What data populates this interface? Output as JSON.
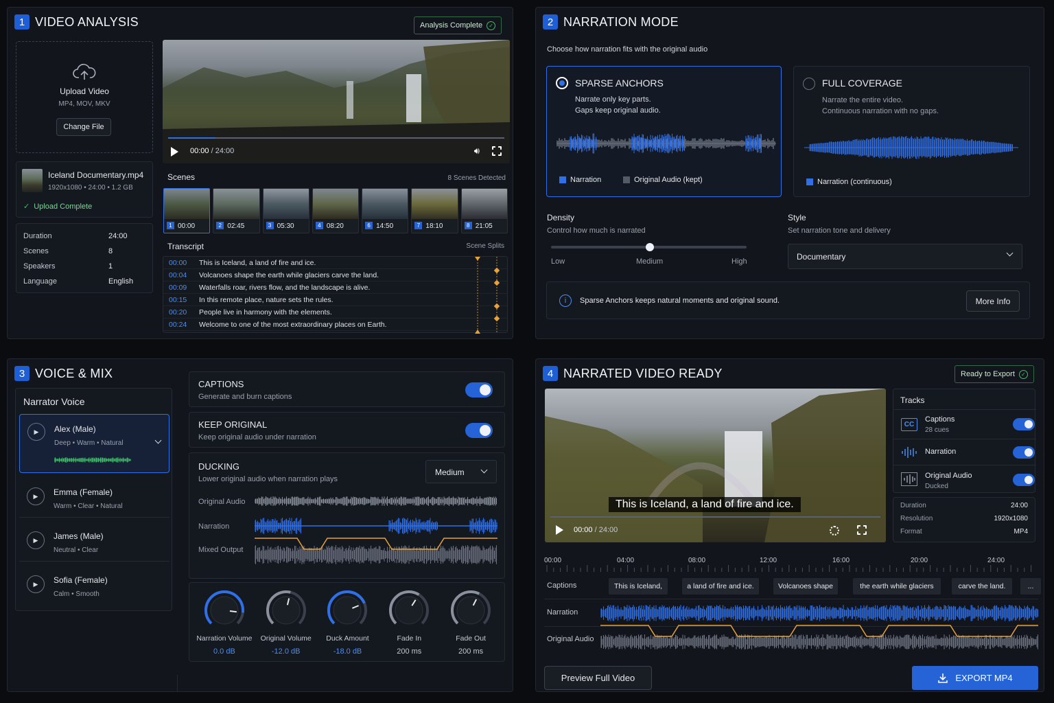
{
  "q1": {
    "num": "1",
    "title": "VIDEO ANALYSIS",
    "badge": "Analysis Complete",
    "upload": {
      "title": "Upload Video",
      "formats": "MP4, MOV, MKV",
      "button": "Change File"
    },
    "file": {
      "name": "Iceland Documentary.mp4",
      "meta": "1920x1080  •  24:00  •  1.2 GB",
      "status": "Upload Complete"
    },
    "stats": [
      {
        "label": "Duration",
        "value": "24:00"
      },
      {
        "label": "Scenes",
        "value": "8"
      },
      {
        "label": "Speakers",
        "value": "1"
      },
      {
        "label": "Language",
        "value": "English"
      }
    ],
    "player": {
      "time": "00:00",
      "total": "/ 24:00"
    },
    "scenes": {
      "label": "Scenes",
      "count": "8 Scenes Detected",
      "items": [
        {
          "n": "1",
          "t": "00:00"
        },
        {
          "n": "2",
          "t": "02:45"
        },
        {
          "n": "3",
          "t": "05:30"
        },
        {
          "n": "4",
          "t": "08:20"
        },
        {
          "n": "6",
          "t": "14:50"
        },
        {
          "n": "7",
          "t": "18:10"
        },
        {
          "n": "8",
          "t": "21:05"
        }
      ]
    },
    "transcript": {
      "label": "Transcript",
      "right": "Scene Splits",
      "rows": [
        {
          "t": "00:00",
          "text": "This is Iceland, a land of fire and ice."
        },
        {
          "t": "00:04",
          "text": "Volcanoes shape the earth while glaciers carve the land."
        },
        {
          "t": "00:09",
          "text": "Waterfalls roar, rivers flow, and the landscape is alive."
        },
        {
          "t": "00:15",
          "text": "In this remote place, nature sets the rules."
        },
        {
          "t": "00:20",
          "text": "People live in harmony with the elements."
        },
        {
          "t": "00:24",
          "text": "Welcome to one of the most extraordinary places on Earth."
        }
      ]
    }
  },
  "q2": {
    "num": "2",
    "title": "NARRATION MODE",
    "subtitle": "Choose how narration fits with the original audio",
    "sparse": {
      "title": "SPARSE ANCHORS",
      "l1": "Narrate only key parts.",
      "l2": "Gaps keep original audio.",
      "legend1": "Narration",
      "legend2": "Original Audio (kept)"
    },
    "full": {
      "title": "FULL COVERAGE",
      "l1": "Narrate the entire video.",
      "l2": "Continuous narration with no gaps.",
      "legend1": "Narration (continuous)"
    },
    "density": {
      "title": "Density",
      "sub": "Control how much is narrated",
      "low": "Low",
      "mid": "Medium",
      "high": "High",
      "level": 0.5
    },
    "style": {
      "title": "Style",
      "sub": "Set narration tone and delivery",
      "value": "Documentary"
    },
    "info": {
      "text": "Sparse Anchors keeps natural moments and original sound.",
      "button": "More Info"
    }
  },
  "q3": {
    "num": "3",
    "title": "VOICE & MIX",
    "voice_title": "Narrator Voice",
    "voices": [
      {
        "name": "Alex (Male)",
        "tags": "Deep  •  Warm  •  Natural"
      },
      {
        "name": "Emma (Female)",
        "tags": "Warm  •  Clear  •  Natural"
      },
      {
        "name": "James (Male)",
        "tags": "Neutral  •  Clear"
      },
      {
        "name": "Sofia (Female)",
        "tags": "Calm  •  Smooth"
      }
    ],
    "captions": {
      "title": "CAPTIONS",
      "sub": "Generate and burn captions"
    },
    "keep": {
      "title": "KEEP ORIGINAL",
      "sub": "Keep original audio under narration"
    },
    "ducking": {
      "title": "DUCKING",
      "sub": "Lower original audio when narration plays",
      "value": "Medium",
      "rows": [
        "Original Audio",
        "Narration",
        "Mixed Output"
      ]
    },
    "knobs": [
      {
        "label": "Narration Volume",
        "value": "0.0 dB"
      },
      {
        "label": "Original Volume",
        "value": "-12.0 dB"
      },
      {
        "label": "Duck Amount",
        "value": "-18.0 dB"
      },
      {
        "label": "Fade In",
        "value": "200 ms"
      },
      {
        "label": "Fade Out",
        "value": "200 ms"
      }
    ]
  },
  "q4": {
    "num": "4",
    "title": "NARRATED VIDEO READY",
    "badge": "Ready to Export",
    "caption_overlay": "This is Iceland, a land of fire and ice.",
    "player": {
      "time": "00:00",
      "total": "/ 24:00"
    },
    "tracks": {
      "title": "Tracks",
      "items": [
        {
          "name": "Captions",
          "sub": "28 cues",
          "icon": "CC"
        },
        {
          "name": "Narration",
          "sub": ""
        },
        {
          "name": "Original Audio",
          "sub": "Ducked"
        }
      ]
    },
    "info": [
      {
        "label": "Duration",
        "value": "24:00"
      },
      {
        "label": "Resolution",
        "value": "1920x1080"
      },
      {
        "label": "Format",
        "value": "MP4"
      }
    ],
    "ruler": [
      "00:00",
      "04:00",
      "08:00",
      "12:00",
      "16:00",
      "20:00",
      "24:00"
    ],
    "timeline_labels": [
      "Captions",
      "Narration",
      "Original Audio"
    ],
    "caption_chips": [
      "This is Iceland,",
      "a land of fire and ice.",
      "Volcanoes shape",
      "the earth while glaciers",
      "carve the land.",
      "..."
    ],
    "preview": "Preview Full Video",
    "export": "EXPORT MP4"
  },
  "colors": {
    "accent": "#2563d6",
    "success": "#3fbf6a",
    "duck": "#e8a23a"
  }
}
